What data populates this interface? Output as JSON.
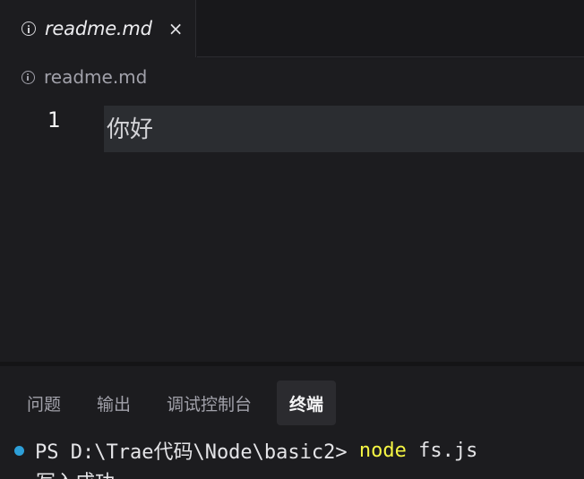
{
  "tab": {
    "label": "readme.md",
    "close_symbol": "×",
    "icon": "info-icon"
  },
  "breadcrumb": {
    "label": "readme.md",
    "icon": "info-icon"
  },
  "editor": {
    "lines": [
      {
        "number": "1",
        "text": "你好"
      }
    ]
  },
  "panel": {
    "tabs": [
      {
        "label": "问题",
        "active": false
      },
      {
        "label": "输出",
        "active": false
      },
      {
        "label": "调试控制台",
        "active": false
      },
      {
        "label": "终端",
        "active": true
      }
    ]
  },
  "terminal": {
    "prompt": "PS D:\\Trae代码\\Node\\basic2> ",
    "command": "node",
    "args": " fs.js",
    "output": "写入成功",
    "status_dot_color": "#2d9fd8"
  },
  "colors": {
    "background": "#1c1c1f",
    "command": "#f5f543",
    "current_line": "#2b2d31"
  }
}
